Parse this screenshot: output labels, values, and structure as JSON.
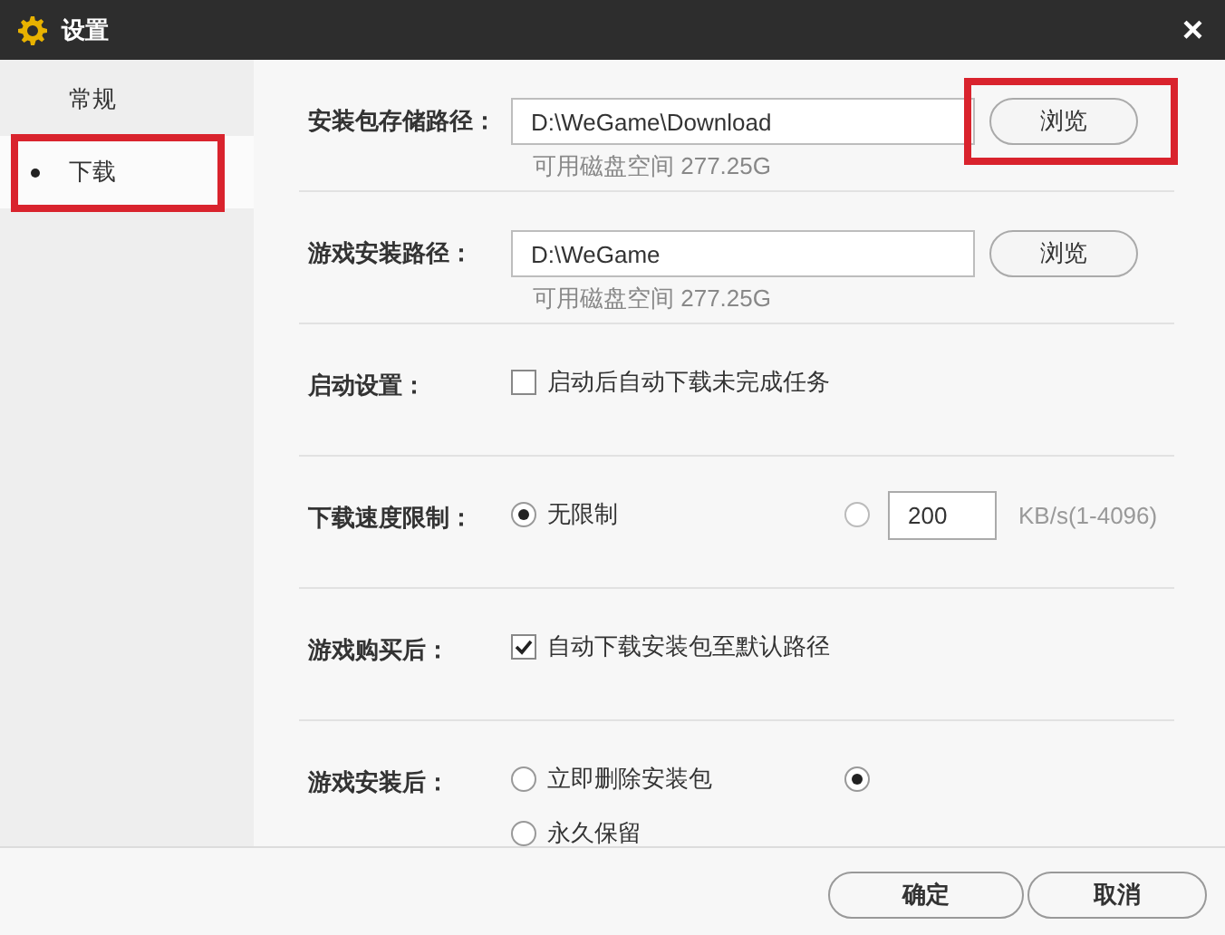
{
  "window": {
    "title": "设置",
    "close": "×"
  },
  "sidebar": {
    "items": [
      {
        "label": "常规",
        "selected": false,
        "highlighted": false
      },
      {
        "label": "下载",
        "selected": true,
        "highlighted": true
      }
    ]
  },
  "sections": [
    {
      "kind": "path",
      "label": "安装包存储路径：",
      "value": "D:\\WeGame\\Download",
      "free_space": "可用磁盘空间 277.25G",
      "button": {
        "label": "浏览",
        "highlighted": true
      }
    },
    {
      "kind": "path",
      "label": "游戏安装路径：",
      "value": "D:\\WeGame",
      "free_space": "可用磁盘空间 277.25G",
      "button": {
        "label": "浏览",
        "highlighted": false
      }
    },
    {
      "kind": "checkbox",
      "label": "启动设置：",
      "options": [
        {
          "label": "启动后自动下载未完成任务",
          "checked": false
        }
      ]
    },
    {
      "kind": "radios",
      "label": "下载速度限制：",
      "options": [
        {
          "label": "无限制",
          "selected": true
        },
        {
          "selected": false,
          "value": "200",
          "unit": "KB/s(1-4096)"
        }
      ]
    },
    {
      "kind": "checkbox",
      "label": "游戏购买后：",
      "options": [
        {
          "label": "自动下载安装包至默认路径",
          "checked": true
        }
      ]
    },
    {
      "kind": "radios",
      "label": "游戏安装后：",
      "options": [
        {
          "label": "立即删除安装包",
          "selected": false
        },
        {
          "selected": true
        },
        {
          "label": "永久保留",
          "selected": false
        }
      ]
    }
  ],
  "footer": {
    "buttons": [
      "确定",
      "取消"
    ]
  }
}
